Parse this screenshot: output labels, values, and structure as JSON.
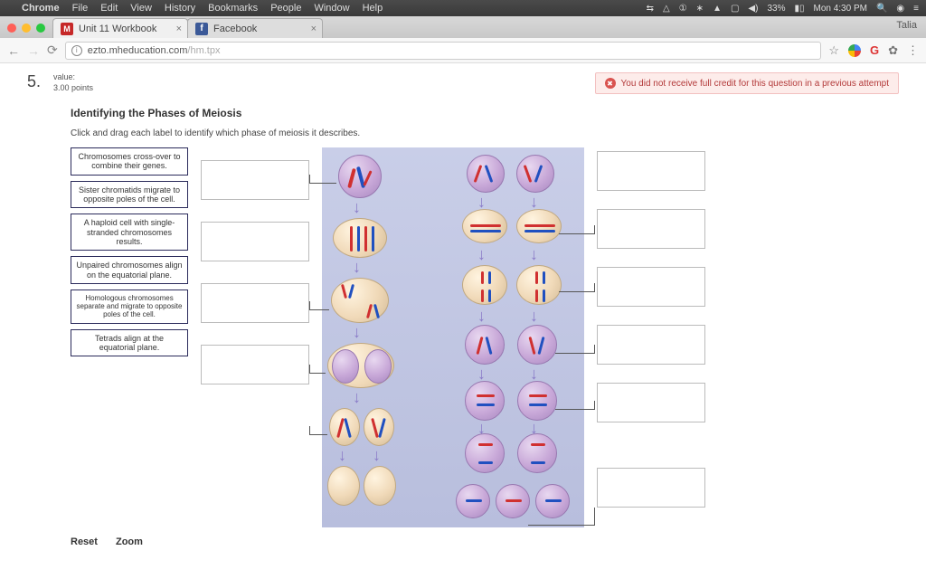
{
  "menubar": {
    "app": "Chrome",
    "items": [
      "File",
      "Edit",
      "View",
      "History",
      "Bookmarks",
      "People",
      "Window",
      "Help"
    ],
    "battery": "33%",
    "time": "Mon 4:30 PM"
  },
  "tabs": [
    {
      "label": "Unit 11 Workbook"
    },
    {
      "label": "Facebook"
    }
  ],
  "user": "Talia",
  "url": {
    "host": "ezto.mheducation.com",
    "path": "/hm.tpx"
  },
  "question": {
    "number": "5.",
    "value_label": "value:",
    "points": "3.00 points",
    "title": "Identifying the Phases of Meiosis",
    "instruction": "Click and drag each label to identify which phase of meiosis it describes."
  },
  "alert": "You did not receive full credit for this question in a previous attempt",
  "labels": [
    "Chromosomes cross-over to combine their genes.",
    "Sister chromatids migrate to opposite poles of the cell.",
    "A haploid cell with single-stranded chromosomes results.",
    "Unpaired chromosomes align on the equatorial plane.",
    "Homologous chromosomes separate and migrate to opposite poles of the cell.",
    "Tetrads align at the equatorial plane."
  ],
  "buttons": {
    "reset": "Reset",
    "zoom": "Zoom"
  }
}
